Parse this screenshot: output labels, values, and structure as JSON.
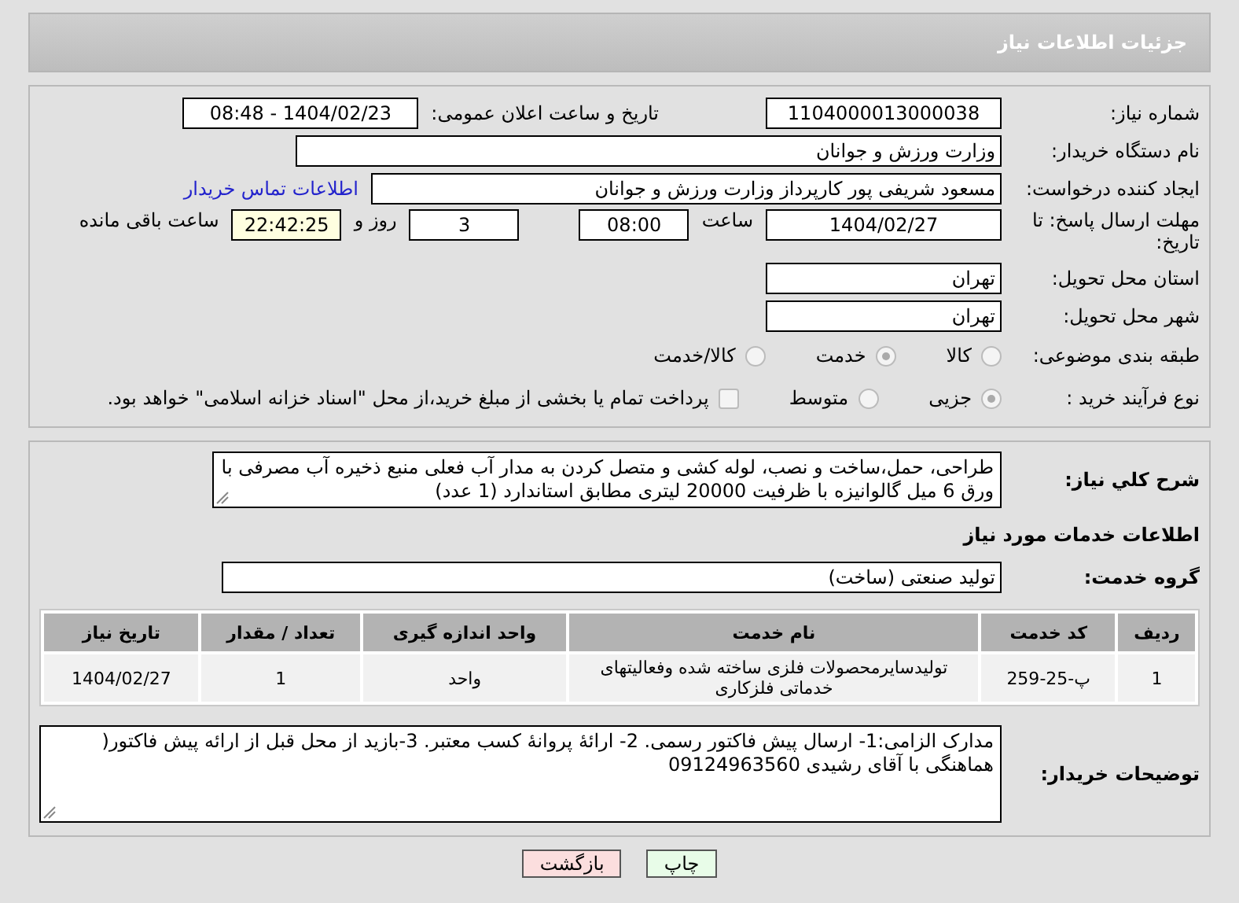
{
  "header": {
    "title": "جزئیات اطلاعات نیاز"
  },
  "details": {
    "need_number": {
      "label": "شماره نیاز:",
      "value": "1104000013000038"
    },
    "announce_date": {
      "label": "تاریخ و ساعت اعلان عمومی:",
      "value": "1404/02/23 - 08:48"
    },
    "buyer_org": {
      "label": "نام دستگاه خریدار:",
      "value": "وزارت ورزش و جوانان"
    },
    "requester": {
      "label": "ایجاد کننده درخواست:",
      "value": "مسعود شریفی پور کارپرداز وزارت ورزش و جوانان",
      "link": "اطلاعات تماس خریدار"
    },
    "deadline": {
      "label": "مهلت ارسال پاسخ: تا تاریخ:",
      "date": "1404/02/27",
      "time_label": "ساعت",
      "time": "08:00",
      "days": "3",
      "days_label": "روز و",
      "remaining": "22:42:25",
      "remaining_label": "ساعت باقی مانده"
    },
    "province": {
      "label": "استان محل تحویل:",
      "value": "تهران"
    },
    "city": {
      "label": "شهر محل تحویل:",
      "value": "تهران"
    },
    "category": {
      "label": "طبقه بندی موضوعی:",
      "options": [
        {
          "label": "کالا",
          "selected": false
        },
        {
          "label": "خدمت",
          "selected": true
        },
        {
          "label": "کالا/خدمت",
          "selected": false
        }
      ]
    },
    "process": {
      "label": "نوع فرآیند خرید :",
      "options": [
        {
          "label": "جزیی",
          "selected": true
        },
        {
          "label": "متوسط",
          "selected": false
        }
      ],
      "treasury": {
        "label": "پرداخت تمام یا بخشی از مبلغ خرید،از محل \"اسناد خزانه اسلامی\" خواهد بود.",
        "checked": false
      }
    }
  },
  "services": {
    "description": {
      "label": "شرح کلي نياز:",
      "value": "طراحی، حمل،ساخت و نصب، لوله کشی و متصل کردن به مدار آب فعلی منبع ذخیره آب مصرفی با ورق 6 میل گالوانیزه با ظرفیت 20000 لیتری مطابق استاندارد (1 عدد)"
    },
    "heading": "اطلاعات خدمات مورد نياز",
    "group": {
      "label": "گروه خدمت:",
      "value": "تولید صنعتی (ساخت)"
    },
    "table": {
      "columns": [
        "ردیف",
        "کد خدمت",
        "نام خدمت",
        "واحد اندازه گیری",
        "تعداد / مقدار",
        "تاریخ نیاز"
      ],
      "rows": [
        [
          "1",
          "پ-25-259",
          "تولیدسایرمحصولات فلزی ساخته شده وفعالیتهای خدماتی فلزکاری",
          "واحد",
          "1",
          "1404/02/27"
        ]
      ]
    },
    "buyer_notes": {
      "label": "توضیحات خریدار:",
      "value": "مدارک الزامی:1- ارسال پیش فاکتور رسمی. 2- ارائۀ پروانۀ کسب معتبر. 3-بازید از محل قبل از ارائه پیش فاکتور( هماهنگی با آقای رشیدی 09124963560"
    }
  },
  "buttons": [
    {
      "label": "چاپ",
      "kind": "print"
    },
    {
      "label": "بازگشت",
      "kind": "back"
    }
  ]
}
